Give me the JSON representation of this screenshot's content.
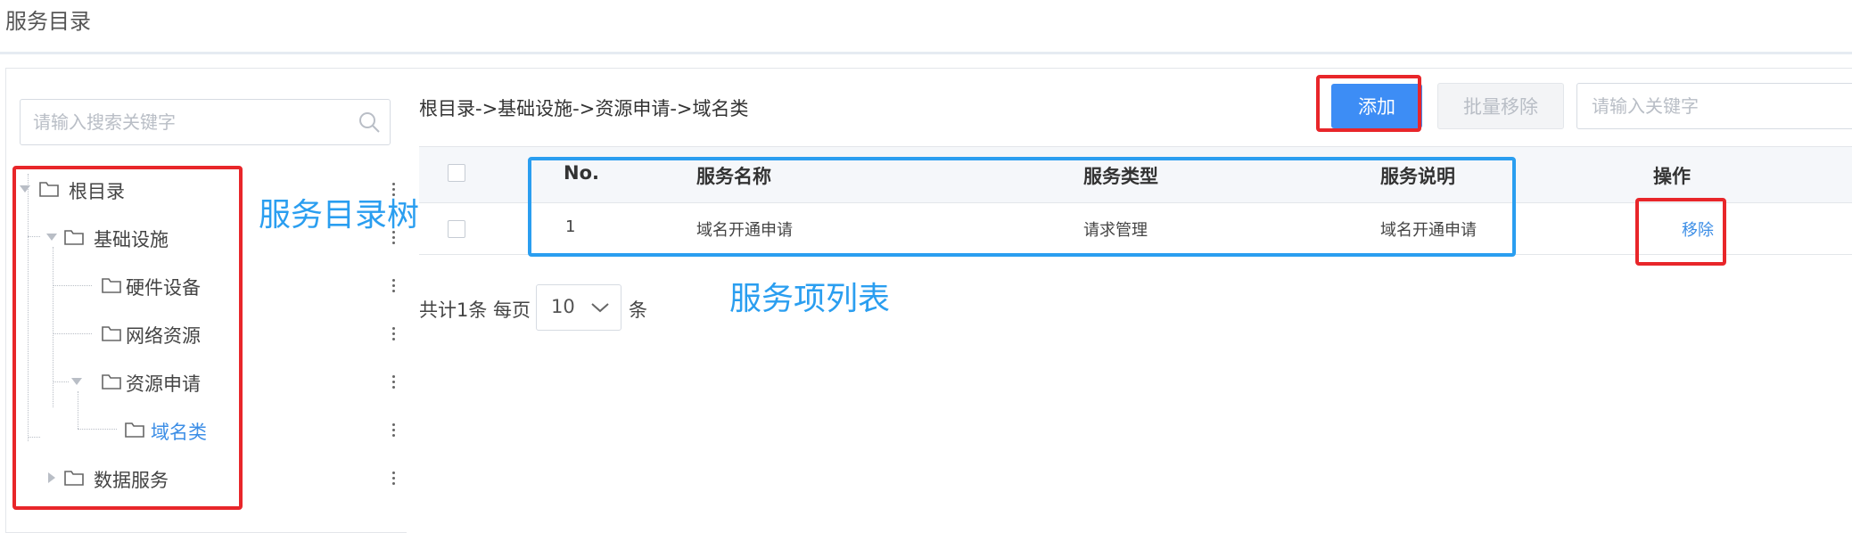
{
  "page": {
    "title": "服务目录"
  },
  "tree": {
    "search_placeholder": "请输入搜索关键字",
    "nodes": [
      {
        "label": "根目录"
      },
      {
        "label": "基础设施"
      },
      {
        "label": "硬件设备"
      },
      {
        "label": "网络资源"
      },
      {
        "label": "资源申请"
      },
      {
        "label": "域名类"
      },
      {
        "label": "数据服务"
      }
    ]
  },
  "main": {
    "breadcrumb": "根目录->基础设施->资源申请->域名类",
    "toolbar": {
      "add_label": "添加",
      "batch_remove_label": "批量移除",
      "keyword_placeholder": "请输入关键字"
    },
    "table": {
      "headers": [
        "No.",
        "服务名称",
        "服务类型",
        "服务说明",
        "操作"
      ],
      "rows": [
        {
          "no": "1",
          "name": "域名开通申请",
          "type": "请求管理",
          "desc": "域名开通申请",
          "action": "移除"
        }
      ]
    },
    "pagination": {
      "total_text": "共计1条 每页",
      "page_size": "10",
      "unit": "条"
    }
  },
  "annotations": {
    "tree_label": "服务目录树",
    "list_label": "服务项列表"
  },
  "colors": {
    "primary": "#3d8df5",
    "link": "#3c8ee6",
    "annotation_red": "#e8262a",
    "annotation_blue": "#2a9ef0"
  }
}
